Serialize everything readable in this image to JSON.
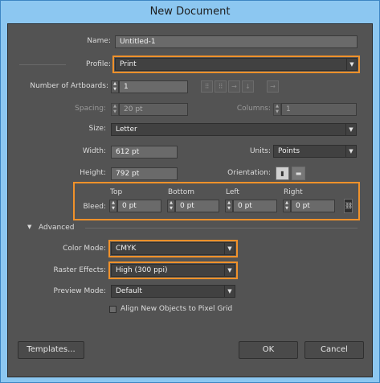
{
  "window": {
    "title": "New Document"
  },
  "fields": {
    "name": {
      "label": "Name:",
      "value": "Untitled-1"
    },
    "profile": {
      "label": "Profile:",
      "value": "Print"
    },
    "artboards": {
      "label": "Number of Artboards:",
      "value": "1"
    },
    "spacing": {
      "label": "Spacing:",
      "value": "20 pt"
    },
    "columns": {
      "label": "Columns:",
      "value": "1"
    },
    "size": {
      "label": "Size:",
      "value": "Letter"
    },
    "width": {
      "label": "Width:",
      "value": "612 pt"
    },
    "units": {
      "label": "Units:",
      "value": "Points"
    },
    "height": {
      "label": "Height:",
      "value": "792 pt"
    },
    "orientation": {
      "label": "Orientation:"
    }
  },
  "bleed": {
    "label": "Bleed:",
    "top": {
      "label": "Top",
      "value": "0 pt"
    },
    "bottom": {
      "label": "Bottom",
      "value": "0 pt"
    },
    "left": {
      "label": "Left",
      "value": "0 pt"
    },
    "right": {
      "label": "Right",
      "value": "0 pt"
    }
  },
  "advanced": {
    "toggle_label": "Advanced",
    "color_mode": {
      "label": "Color Mode:",
      "value": "CMYK"
    },
    "raster_effects": {
      "label": "Raster Effects:",
      "value": "High (300 ppi)"
    },
    "preview_mode": {
      "label": "Preview Mode:",
      "value": "Default"
    },
    "align_pixel_grid": {
      "label": "Align New Objects to Pixel Grid",
      "checked": false
    }
  },
  "buttons": {
    "templates": "Templates...",
    "ok": "OK",
    "cancel": "Cancel"
  },
  "colors": {
    "highlight": "#f0912a",
    "panel": "#535353",
    "titlebar": "#8cc7f1"
  }
}
